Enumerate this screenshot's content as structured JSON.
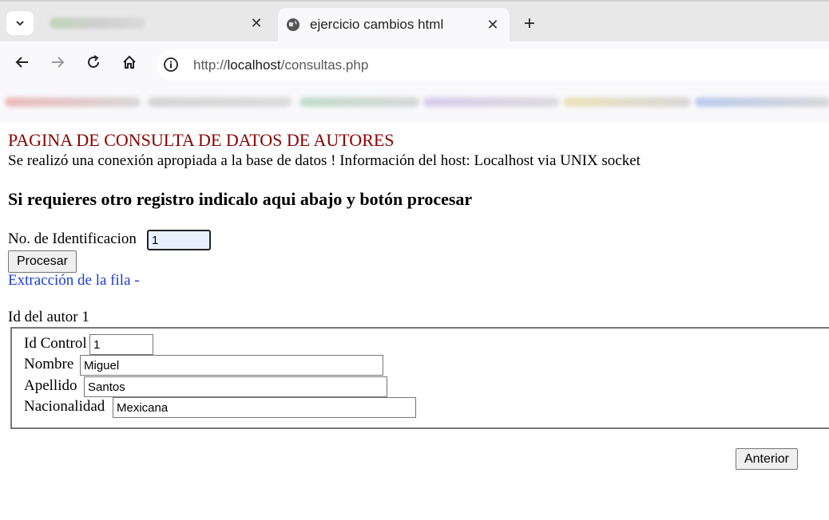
{
  "browser": {
    "active_tab_title": "ejercicio cambios html",
    "url_prefix": "http://",
    "url_host": "localhost",
    "url_path": "/consultas.php"
  },
  "page": {
    "title": "PAGINA DE CONSULTA DE DATOS DE AUTORES",
    "connection_info": "Se realizó una conexión apropiada a la base de datos ! Información del host: Localhost via UNIX socket",
    "subheading": "Si requieres otro registro indicalo aqui abajo y botón procesar",
    "id_label": "No. de Identificacion",
    "id_value": "1",
    "process_button": "Procesar",
    "extraction_text": "Extracción de la fila -",
    "author_label": "Id del autor 1",
    "fields": {
      "id_control_label": "Id Control",
      "id_control_value": "1",
      "nombre_label": "Nombre",
      "nombre_value": "Miguel",
      "apellido_label": "Apellido",
      "apellido_value": "Santos",
      "nacionalidad_label": "Nacionalidad",
      "nacionalidad_value": "Mexicana"
    },
    "previous_button": "Anterior"
  },
  "colors": {
    "title": "#8b0000",
    "link": "#1a3cd6",
    "input_highlight": "#e8f0fe"
  }
}
